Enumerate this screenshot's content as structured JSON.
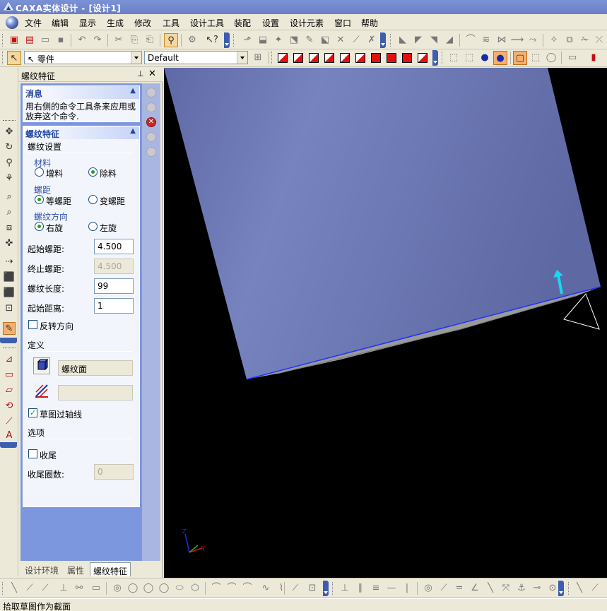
{
  "title": "CAXA实体设计 - [设计1]",
  "menu": [
    "文件",
    "编辑",
    "显示",
    "生成",
    "修改",
    "工具",
    "设计工具",
    "装配",
    "设置",
    "设计元素",
    "窗口",
    "帮助"
  ],
  "toolbar2": {
    "select_combo": "零件",
    "style_combo": "Default"
  },
  "panel": {
    "title": "螺纹特征",
    "message_group": {
      "title": "消息",
      "text_line1": "用右侧的命令工具条来应用或",
      "text_line2": "放弃这个命令."
    },
    "thread_group": {
      "title": "螺纹特征",
      "settings_label": "螺纹设置",
      "material_label": "材料",
      "add_material": "增料",
      "remove_material": "除料",
      "material_selected": "除料",
      "pitch_label": "螺距",
      "equal_pitch": "等螺距",
      "variable_pitch": "变螺距",
      "pitch_selected": "等螺距",
      "direction_label": "螺纹方向",
      "right_hand": "右旋",
      "left_hand": "左旋",
      "direction_selected": "右旋",
      "start_pitch_label": "起始螺距:",
      "start_pitch_value": "4.500",
      "end_pitch_label": "终止螺距:",
      "end_pitch_value": "4.500",
      "length_label": "螺纹长度:",
      "length_value": "99",
      "start_distance_label": "起始距离:",
      "start_distance_value": "1",
      "reverse_label": "反转方向",
      "reverse_checked": false,
      "define_label": "定义",
      "thread_face_value": "螺纹面",
      "profile_value": "",
      "sketch_axis_label": "草图过轴线",
      "sketch_axis_checked": true,
      "options_label": "选项",
      "tail_label": "收尾",
      "tail_checked": false,
      "tail_turns_label": "收尾圈数:",
      "tail_turns_value": "0"
    },
    "tabs": [
      "设计环境",
      "属性",
      "螺纹特征"
    ],
    "active_tab": "螺纹特征"
  },
  "viewport": {
    "background": "#000000",
    "solid_color": "#6E79B5",
    "edge_color": "#1E32FF",
    "arrow_color": "#18D8F0"
  },
  "status": "拾取草图作为截面"
}
